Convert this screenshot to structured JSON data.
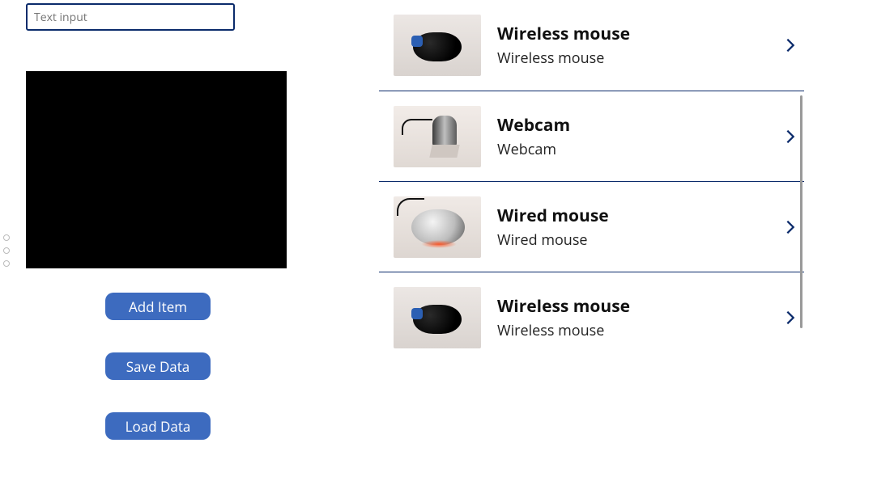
{
  "colors": {
    "accent": "#0b2b6b",
    "button_bg": "#3d6bbf",
    "button_text": "#ffffff"
  },
  "left": {
    "input_placeholder": "Text input",
    "input_value": "",
    "buttons": {
      "add": "Add Item",
      "save": "Save Data",
      "load": "Load Data"
    }
  },
  "list": [
    {
      "title": "Wireless mouse",
      "subtitle": "Wireless mouse",
      "thumb": "wireless-mouse"
    },
    {
      "title": "Webcam",
      "subtitle": "Webcam",
      "thumb": "webcam"
    },
    {
      "title": "Wired mouse",
      "subtitle": "Wired mouse",
      "thumb": "wired-mouse"
    },
    {
      "title": "Wireless mouse",
      "subtitle": "Wireless mouse",
      "thumb": "wireless-mouse"
    }
  ]
}
